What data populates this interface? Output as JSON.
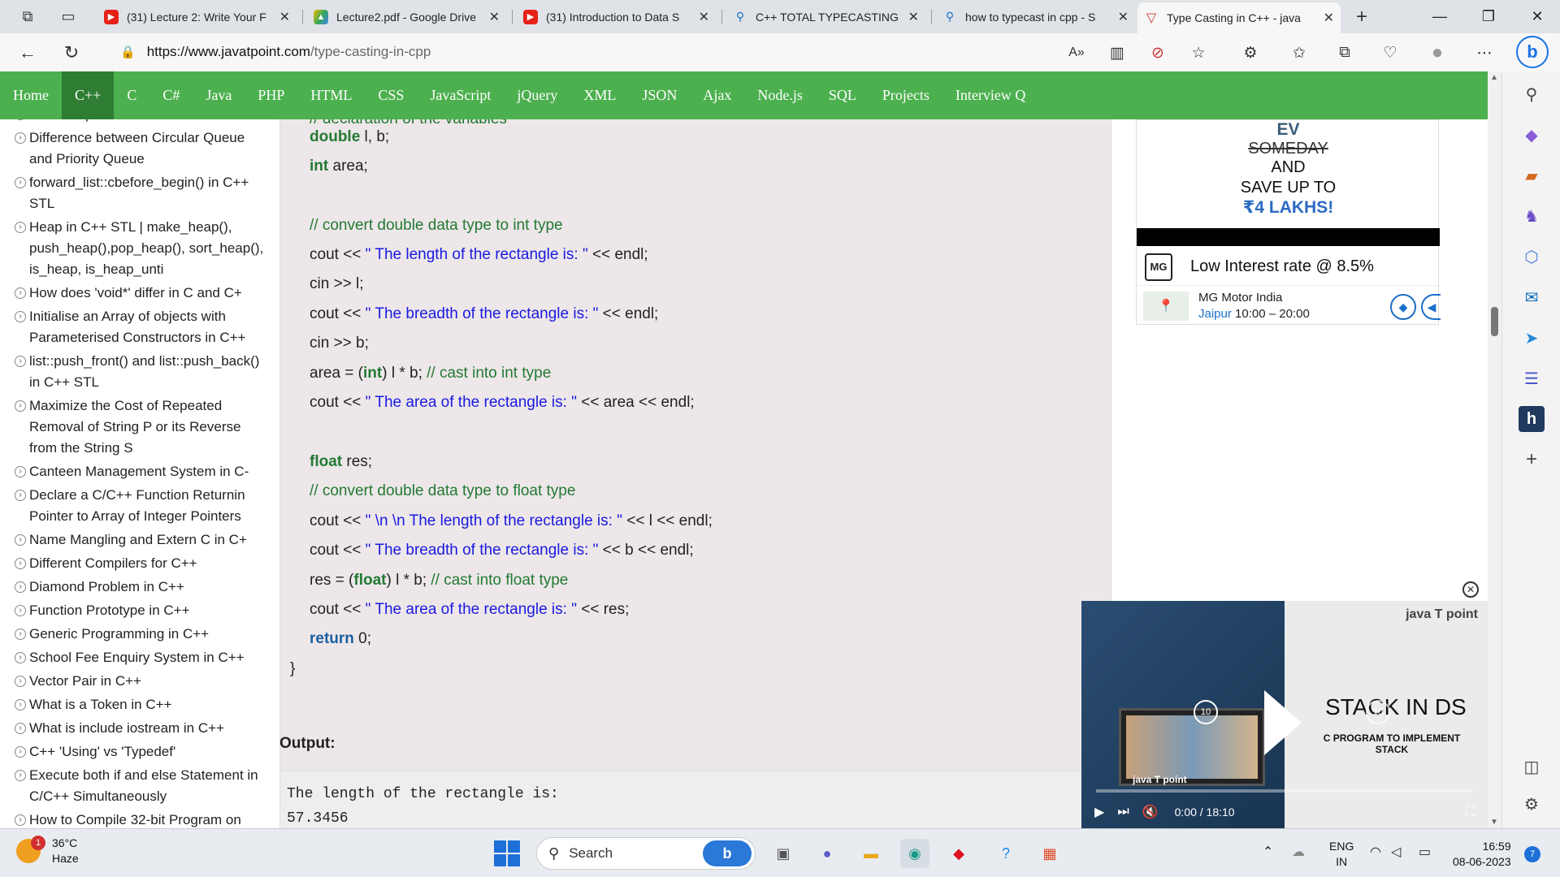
{
  "browser": {
    "tabs": [
      {
        "title": "(31) Lecture 2: Write Your F",
        "icon": "youtube-icon",
        "color": "#e62117"
      },
      {
        "title": "Lecture2.pdf - Google Drive",
        "icon": "google-drive-icon",
        "color": "#1fa463"
      },
      {
        "title": "(31) Introduction to Data S",
        "icon": "youtube-icon",
        "color": "#e62117"
      },
      {
        "title": "C++ TOTAL TYPECASTING",
        "icon": "search-icon",
        "color": "#1a6fc8"
      },
      {
        "title": "how to typecast in cpp - S",
        "icon": "search-icon",
        "color": "#1a6fc8"
      },
      {
        "title": "Type Casting in C++ - java",
        "icon": "javatpoint-icon",
        "color": "#d0302f"
      }
    ],
    "url_host": "https://www.javatpoint.com",
    "url_path": "/type-casting-in-cpp"
  },
  "site_nav": {
    "items": [
      "Home",
      "C++",
      "C",
      "C#",
      "Java",
      "PHP",
      "HTML",
      "CSS",
      "JavaScript",
      "jQuery",
      "XML",
      "JSON",
      "Ajax",
      "Node.js",
      "SQL",
      "Projects",
      "Interview Q"
    ],
    "active": "C++",
    "color": "#4cb04f"
  },
  "sidebar": {
    "items": [
      "C++ Pre-processors",
      "Difference between Circular Queue and Priority Queue",
      "forward_list::cbefore_begin() in C++ STL",
      "Heap in C++ STL | make_heap(), push_heap(),pop_heap(), sort_heap(), is_heap, is_heap_unti",
      "How does 'void*' differ in C and C+",
      "Initialise an Array of objects with Parameterised Constructors in C++",
      "list::push_front() and list::push_back() in C++ STL",
      "Maximize the Cost of Repeated Removal of String P or its Reverse from the String S",
      "Canteen Management System in C-",
      "Declare a C/C++ Function Returnin Pointer to Array of Integer Pointers",
      "Name Mangling and Extern C in C+",
      "Different Compilers for C++",
      "Diamond Problem in C++",
      "Function Prototype in C++",
      "Generic Programming in C++",
      "School Fee Enquiry System in C++",
      "Vector Pair in C++",
      "What is a Token in C++",
      "What is include iostream in C++",
      "C++ 'Using' vs 'Typedef'",
      "Execute both if and else Statement in C/C++ Simultaneously",
      "How to Compile 32-bit Program on"
    ]
  },
  "code": {
    "l0": "// declaration of the variables",
    "l1_kw": "double",
    "l1_rest": " l, b;",
    "l2_kw": "int",
    "l2_rest": " area;",
    "l3": "// convert double data type to int type",
    "l4_a": "cout << ",
    "l4_s": "\" The length of the rectangle is: \"",
    "l4_b": " << endl;",
    "l5": "cin >> l;",
    "l6_a": "cout << ",
    "l6_s": "\" The breadth of the rectangle is: \"",
    "l6_b": " << endl;",
    "l7": "cin >> b;",
    "l8_a": "area = (",
    "l8_kw": "int",
    "l8_b": ") l * b; ",
    "l8_c": "// cast into int type",
    "l9_a": "cout << ",
    "l9_s": "\" The area of the rectangle is: \"",
    "l9_b": " << area << endl;",
    "l10_kw": "float",
    "l10_rest": " res;",
    "l11": "// convert double data type to float type",
    "l12_a": "cout << ",
    "l12_s": "\" \\n \\n The length of the rectangle is: \"",
    "l12_b": " << l << endl;",
    "l13_a": "cout << ",
    "l13_s": "\" The breadth of the rectangle is: \"",
    "l13_b": " << b << endl;",
    "l14_a": "res = (",
    "l14_kw": "float",
    "l14_b": ") l * b; ",
    "l14_c": "// cast into float type",
    "l15_a": "cout << ",
    "l15_s": "\" The area of the rectangle is: \"",
    "l15_b": " << res;",
    "l16_kw": "return",
    "l16_rest": " 0;",
    "l17": "}"
  },
  "output": {
    "heading": "Output:",
    "line1": "The length of the rectangle is:",
    "line2": "57.3456"
  },
  "ad": {
    "line1": "EV",
    "line2": "SOMEDAY",
    "line3": "AND",
    "line4": "SAVE UP TO",
    "line5": "₹4 LAKHS!",
    "rate": "Low Interest rate @ 8.5%",
    "business": "MG Motor India",
    "location": "Jaipur",
    "hours": "10:00 – 20:00",
    "logo": "MG"
  },
  "video": {
    "brand": "java T point",
    "title": "STACK IN DS",
    "subtitle": "C PROGRAM TO IMPLEMENT STACK",
    "thumb_brand": "java T point",
    "time": "0:00 / 18:10",
    "skip": "10",
    "progress": 0
  },
  "taskbar": {
    "temp": "36°C",
    "weather": "Haze",
    "weather_badge": "1",
    "search": "Search",
    "lang1": "ENG",
    "lang2": "IN",
    "time": "16:59",
    "date": "08-06-2023",
    "notif": "7"
  }
}
